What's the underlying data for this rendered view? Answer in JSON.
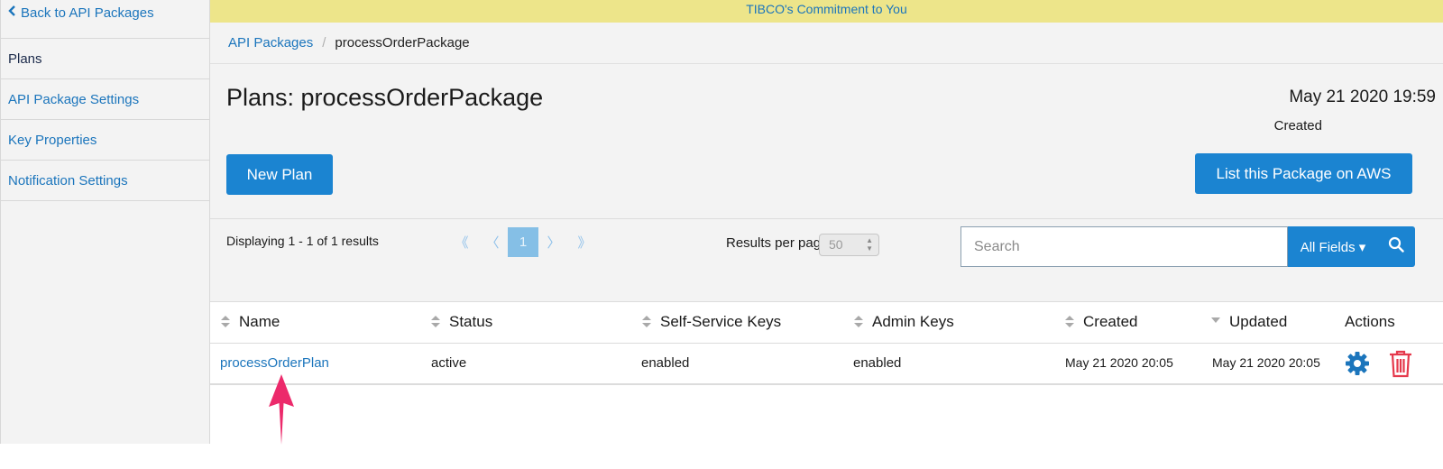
{
  "banner": {
    "text": "TIBCO's Commitment to You"
  },
  "sidebar": {
    "back_label": "Back to API Packages",
    "items": [
      {
        "label": "Plans",
        "active": true
      },
      {
        "label": "API Package Settings",
        "active": false
      },
      {
        "label": "Key Properties",
        "active": false
      },
      {
        "label": "Notification Settings",
        "active": false
      }
    ]
  },
  "breadcrumb": {
    "parent": "API Packages",
    "separator": "/",
    "current": "processOrderPackage"
  },
  "header": {
    "title": "Plans: processOrderPackage",
    "created_date": "May 21 2020 19:59",
    "created_label": "Created",
    "new_plan_label": "New Plan",
    "aws_label": "List this Package on AWS"
  },
  "toolbar": {
    "displaying": "Displaying 1 - 1 of 1 results",
    "pager": {
      "first": "《",
      "prev": "〈",
      "current": "1",
      "next": "〉",
      "last": "》"
    },
    "rpp_label": "Results per page:",
    "rpp_value": "50",
    "search_placeholder": "Search",
    "fields_label": "All Fields ▾"
  },
  "table": {
    "columns": [
      "Name",
      "Status",
      "Self-Service Keys",
      "Admin Keys",
      "Created",
      "Updated",
      "Actions"
    ],
    "rows": [
      {
        "name": "processOrderPlan",
        "status": "active",
        "self_service_keys": "enabled",
        "admin_keys": "enabled",
        "created": "May 21 2020 20:05",
        "updated": "May 21 2020 20:05"
      }
    ]
  },
  "colors": {
    "accent": "#1b84d1",
    "link": "#1b75bc",
    "banner_bg": "#ede58a",
    "delete": "#e5394c",
    "annotation": "#ec2a6b"
  },
  "icons": {
    "back": "chevron-left-icon",
    "search": "search-icon",
    "edit": "gear-icon",
    "delete": "trash-icon",
    "annotation": "arrow-up-icon"
  }
}
